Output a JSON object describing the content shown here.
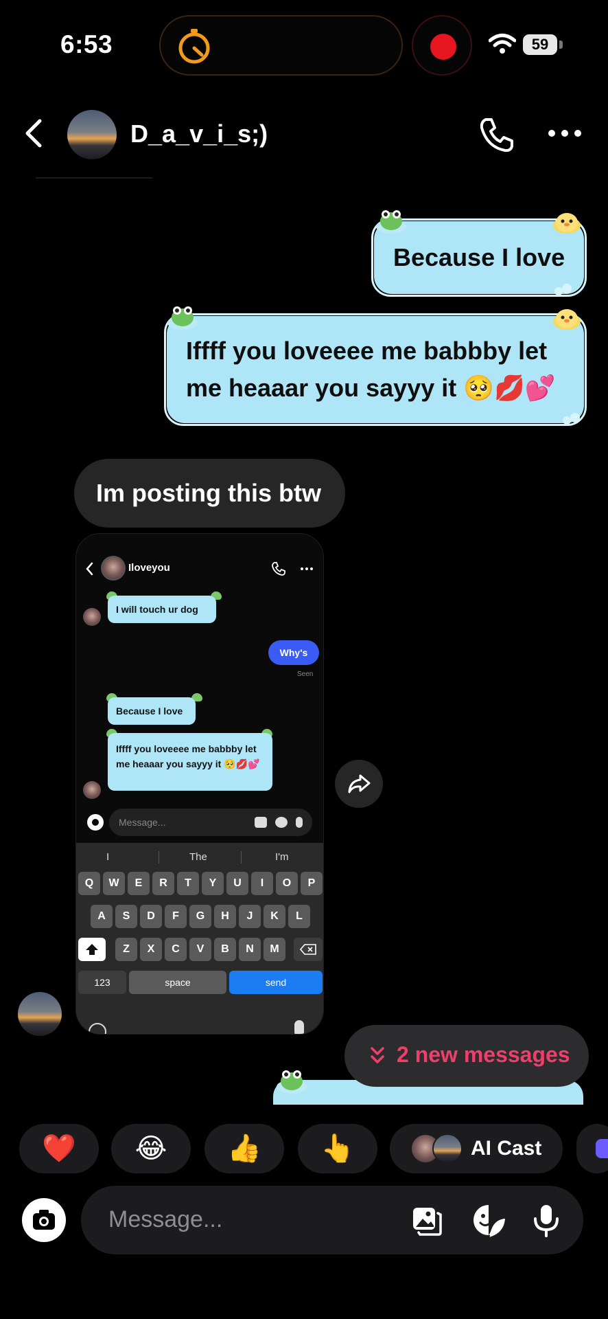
{
  "status_bar": {
    "time": "6:53",
    "battery": "59"
  },
  "header": {
    "contact_name": "D_a_v_i_s;)"
  },
  "messages": {
    "sent_1": "Because I love",
    "sent_2": "Iffff you loveeee me babbby let me heaaar you sayyy it 🥺💋💕",
    "received_1": "Im posting this btw"
  },
  "shared_screenshot": {
    "contact_name": "Iloveyou",
    "msg_1": "I will touch ur dog",
    "msg_2": "Why's",
    "seen": "Seen",
    "msg_3": "Because I love",
    "msg_4": "Iffff you loveeee me babbby let me heaaar you sayyy it 🥺💋💕",
    "placeholder": "Message...",
    "suggestions": [
      "I",
      "The",
      "I'm"
    ],
    "keys_row1": [
      "Q",
      "W",
      "E",
      "R",
      "T",
      "Y",
      "U",
      "I",
      "O",
      "P"
    ],
    "keys_row2": [
      "A",
      "S",
      "D",
      "F",
      "G",
      "H",
      "J",
      "K",
      "L"
    ],
    "keys_row3": [
      "Z",
      "X",
      "C",
      "V",
      "B",
      "N",
      "M"
    ],
    "key_123": "123",
    "key_space": "space",
    "key_send": "send"
  },
  "new_messages": {
    "label": "2 new messages",
    "color": "#ef3e6c"
  },
  "reactions": {
    "heart": "❤️",
    "laugh": "😂",
    "thumbs": "👍",
    "point": "👆",
    "ai_cast": "AI Cast"
  },
  "composer": {
    "placeholder": "Message..."
  },
  "colors": {
    "bubble_theme": "#aee6f8",
    "received_bubble": "#262626",
    "record": "#e5161f",
    "timer": "#f29a1a"
  },
  "icons": [
    "back-icon",
    "phone-icon",
    "more-icon",
    "share-icon",
    "camera-icon",
    "gallery-icon",
    "sticker-icon",
    "mic-icon",
    "timer-icon",
    "wifi-icon",
    "chevrons-down-icon"
  ]
}
